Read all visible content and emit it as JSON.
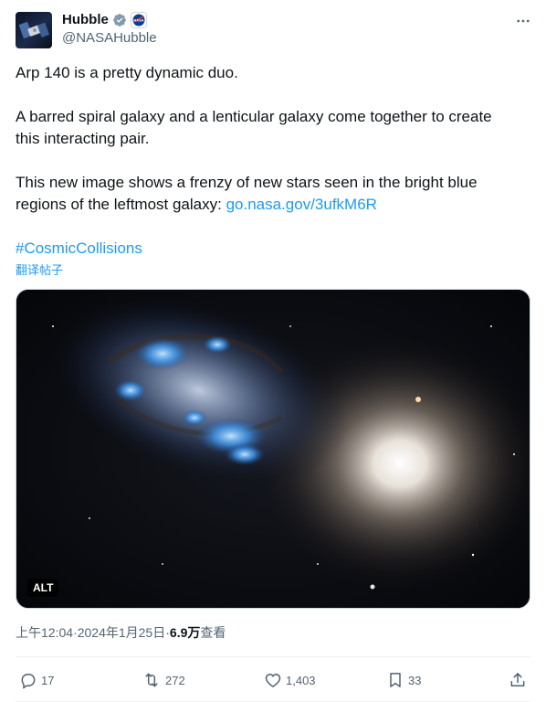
{
  "author": {
    "display_name": "Hubble",
    "handle": "@NASAHubble",
    "verified_icon": "verified-badge-icon",
    "affiliate_icon": "nasa-logo-icon"
  },
  "post": {
    "line1": "Arp 140 is a pretty dynamic duo.",
    "para2_line1": "A barred spiral galaxy and a lenticular galaxy come together to create",
    "para2_line2": "this interacting pair.",
    "para3_line1": "This new image shows a frenzy of new stars seen in the bright blue",
    "para3_line2_text": "regions of the leftmost galaxy: ",
    "para3_link": "go.nasa.gov/3ufkM6R",
    "hashtag": "#CosmicCollisions",
    "translate": "翻译帖子"
  },
  "media": {
    "alt_badge": "ALT"
  },
  "meta": {
    "time": "上午12:04",
    "sep1": " · ",
    "date": "2024年1月25日",
    "sep2": " · ",
    "views_count": "6.9万",
    "views_label": " 查看"
  },
  "actions": {
    "replies": "17",
    "reposts": "272",
    "likes": "1,403",
    "bookmarks": "33"
  },
  "colors": {
    "link": "#1d9bf0",
    "text": "#0f1419",
    "secondary": "#536471",
    "verified": "#829aab"
  }
}
